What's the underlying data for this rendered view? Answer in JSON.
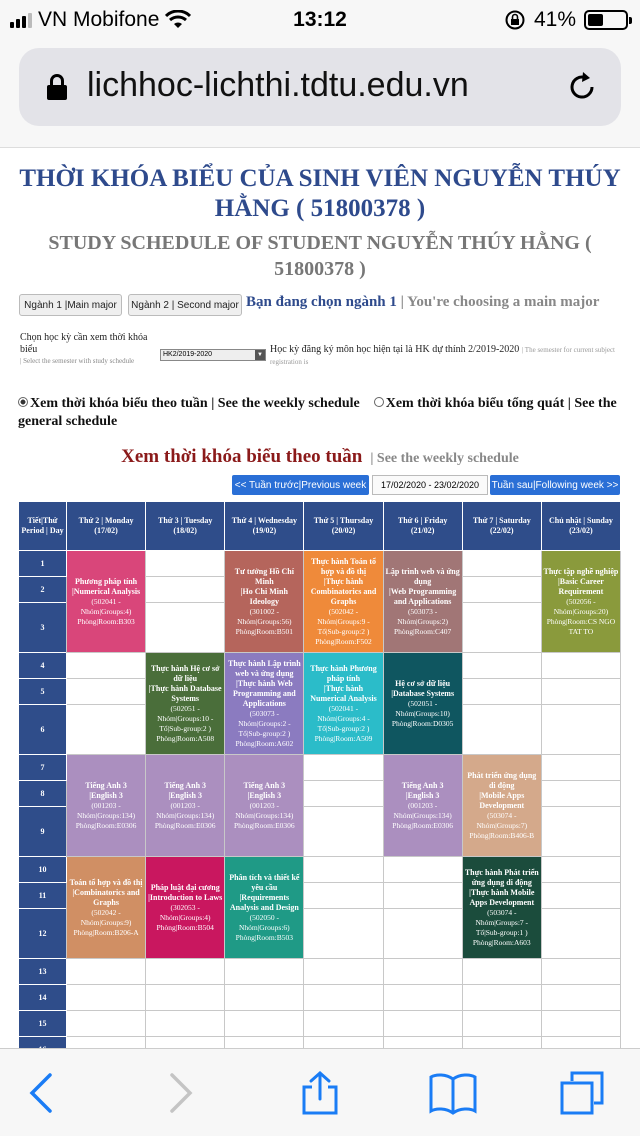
{
  "status": {
    "carrier": "VN Mobifone",
    "time": "13:12",
    "battery": "41%"
  },
  "browser": {
    "url": "lichhoc-lichthi.tdtu.edu.vn"
  },
  "title_vi": "THỜI KHÓA BIỂU CỦA SINH VIÊN NGUYỄN THÚY HẰNG ( 51800378 )",
  "title_en": "STUDY SCHEDULE OF STUDENT NGUYỄN THÚY HẰNG ( 51800378 )",
  "major": {
    "btn1": "Ngành 1 |Main major",
    "btn2": "Ngành 2 | Second major",
    "chosen": "Bạn đang chọn ngành 1",
    "chosen_en": "| You're choosing a main major"
  },
  "semester": {
    "label": "Chọn học kỳ cần xem thời khóa biểu",
    "label_en": "| Select the semester with study schedule",
    "selected": "HK2/2019-2020",
    "current": "Học kỳ đăng ký môn học hiện tại là HK dự thính 2/2019-2020",
    "current_en": "| The semester for current subject registration is"
  },
  "view": {
    "weekly": "Xem thời khóa biểu theo tuần | See the weekly schedule",
    "general": "Xem thời khóa biểu tổng quát | See the general schedule"
  },
  "week": {
    "title": "Xem thời khóa biểu theo tuần",
    "title_en": "| See the weekly schedule",
    "prev": "<< Tuần trước|Previous week",
    "range": "17/02/2020 - 23/02/2020",
    "next": "Tuần sau|Following week >>"
  },
  "table": {
    "corner": "Tiết|Thứ Period | Day",
    "days": [
      {
        "name": "Thứ 2 | Monday",
        "date": "(17/02)"
      },
      {
        "name": "Thứ 3 | Tuesday",
        "date": "(18/02)"
      },
      {
        "name": "Thứ 4 | Wednesday",
        "date": "(19/02)"
      },
      {
        "name": "Thứ 5 | Thursday",
        "date": "(20/02)"
      },
      {
        "name": "Thứ 6 | Friday",
        "date": "(21/02)"
      },
      {
        "name": "Thứ 7 | Saturday",
        "date": "(22/02)"
      },
      {
        "name": "Chủ nhật | Sunday",
        "date": "(23/02)"
      }
    ],
    "periods": [
      "1",
      "2",
      "3",
      "4",
      "5",
      "6",
      "7",
      "8",
      "9",
      "10",
      "11",
      "12",
      "13",
      "14",
      "15",
      "16"
    ],
    "events": [
      {
        "day": 0,
        "start": 1,
        "span": 3,
        "color": "#d9467a",
        "title": "Phương pháp tính",
        "sub": "|Numerical Analysis",
        "detail": "(502041 - Nhóm|Groups:4) Phòng|Room:B303"
      },
      {
        "day": 2,
        "start": 1,
        "span": 3,
        "color": "#b5655c",
        "title": "Tư tưởng Hồ Chí Minh",
        "sub": "|Ho Chi Minh Ideology",
        "detail": "(301002 - Nhóm|Groups:56) Phòng|Room:B501"
      },
      {
        "day": 3,
        "start": 1,
        "span": 3,
        "color": "#ef8a3a",
        "title": "Thực hành Toán tổ hợp và đồ thị",
        "sub": "|Thực hành Combinatorics and Graphs",
        "detail": "(502042 - Nhóm|Groups:9 - Tổ|Sub-group:2 ) Phòng|Room:F502"
      },
      {
        "day": 4,
        "start": 1,
        "span": 3,
        "color": "#a17676",
        "title": "Lập trình web và ứng dụng",
        "sub": "|Web Programming and Applications",
        "detail": "(503073 - Nhóm|Groups:2) Phòng|Room:C407"
      },
      {
        "day": 6,
        "start": 1,
        "span": 3,
        "color": "#8a9a3c",
        "title": "Thực tập nghề nghiệp",
        "sub": "|Basic Career Requirement",
        "detail": "(502056 - Nhóm|Groups:20) Phòng|Room:CS NGO TAT TO"
      },
      {
        "day": 1,
        "start": 4,
        "span": 3,
        "color": "#4a6e3a",
        "title": "Thực hành Hệ cơ sở dữ liệu",
        "sub": "|Thực hành Database Systems",
        "detail": "(502051 - Nhóm|Groups:10 - Tổ|Sub-group:2 ) Phòng|Room:A508"
      },
      {
        "day": 2,
        "start": 4,
        "span": 3,
        "color": "#8b7bc0",
        "title": "Thực hành Lập trình web và ứng dụng",
        "sub": "|Thực hành Web Programming and Applications",
        "detail": "(503073 - Nhóm|Groups:2 - Tổ|Sub-group:2 ) Phòng|Room:A602"
      },
      {
        "day": 3,
        "start": 4,
        "span": 3,
        "color": "#2bbcc9",
        "title": "Thực hành Phương pháp tính",
        "sub": "|Thực hành Numerical Analysis",
        "detail": "(502041 - Nhóm|Groups:4 - Tổ|Sub-group:2 ) Phòng|Room:A509"
      },
      {
        "day": 4,
        "start": 4,
        "span": 3,
        "color": "#0f5660",
        "title": "Hệ cơ sở dữ liệu",
        "sub": "|Database Systems",
        "detail": "(502051 - Nhóm|Groups:10) Phòng|Room:D0305"
      },
      {
        "day": 0,
        "start": 7,
        "span": 3,
        "color": "#ab8fbf",
        "title": "Tiếng Anh 3",
        "sub": "|English 3",
        "detail": "(001203 - Nhóm|Groups:134) Phòng|Room:E0306"
      },
      {
        "day": 1,
        "start": 7,
        "span": 3,
        "color": "#ab8fbf",
        "title": "Tiếng Anh 3",
        "sub": "|English 3",
        "detail": "(001203 - Nhóm|Groups:134) Phòng|Room:E0306"
      },
      {
        "day": 2,
        "start": 7,
        "span": 3,
        "color": "#ab8fbf",
        "title": "Tiếng Anh 3",
        "sub": "|English 3",
        "detail": "(001203 - Nhóm|Groups:134) Phòng|Room:E0306"
      },
      {
        "day": 4,
        "start": 7,
        "span": 3,
        "color": "#ab8fbf",
        "title": "Tiếng Anh 3",
        "sub": "|English 3",
        "detail": "(001203 - Nhóm|Groups:134) Phòng|Room:E0306"
      },
      {
        "day": 5,
        "start": 7,
        "span": 3,
        "color": "#d4a98b",
        "title": "Phát triển ứng dụng di động",
        "sub": "|Mobile Apps Development",
        "detail": "(503074 - Nhóm|Groups:7) Phòng|Room:B406-B"
      },
      {
        "day": 0,
        "start": 10,
        "span": 3,
        "color": "#d08f64",
        "title": "Toán tổ hợp và đồ thị",
        "sub": "|Combinatorics and Graphs",
        "detail": "(502042 - Nhóm|Groups:9) Phòng|Room:B206-A"
      },
      {
        "day": 1,
        "start": 10,
        "span": 3,
        "color": "#c9175f",
        "title": "Pháp luật đại cương",
        "sub": "|Introduction to Laws",
        "detail": "(302053 - Nhóm|Groups:4) Phòng|Room:B504"
      },
      {
        "day": 2,
        "start": 10,
        "span": 3,
        "color": "#1f9a86",
        "title": "Phân tích và thiết kế yêu cầu",
        "sub": "|Requirements Analysis and Design",
        "detail": "(502050 - Nhóm|Groups:6) Phòng|Room:B503"
      },
      {
        "day": 5,
        "start": 10,
        "span": 3,
        "color": "#1b4c3c",
        "title": "Thực hành Phát triển ứng dụng di động",
        "sub": "|Thực hành Mobile Apps Development",
        "detail": "(503074 - Nhóm|Groups:7 - Tổ|Sub-group:1 ) Phòng|Room:A603"
      }
    ]
  },
  "colors": {
    "header": "#2f4d8a",
    "title": "#2e4a8c",
    "week_title": "#8b1a1a",
    "nav_button": "#2a6fd6",
    "ios_blue": "#1a7cf5"
  },
  "toolbar_icons": [
    "back-icon",
    "forward-icon",
    "share-icon",
    "bookmarks-icon",
    "tabs-icon"
  ]
}
